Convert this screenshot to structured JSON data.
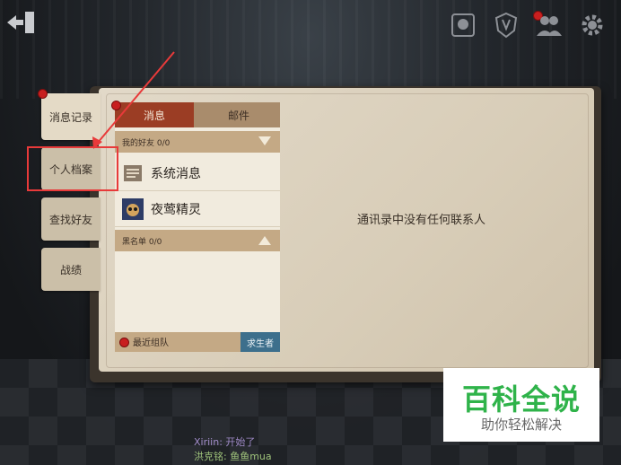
{
  "topbar": {
    "icons": [
      "exit-icon",
      "portrait-icon",
      "shield-icon",
      "friends-icon",
      "gear-icon"
    ]
  },
  "side_tabs": {
    "messages": "消息记录",
    "profile": "个人档案",
    "find_friends": "查找好友",
    "record": "战绩"
  },
  "panel": {
    "tab_messages": "消息",
    "tab_mail": "邮件",
    "friends_group": "我的好友  0/0",
    "rows": [
      "系统消息",
      "夜莺精灵"
    ],
    "blacklist_group": "黑名单  0/0",
    "recent_team": "最近组队",
    "survivor_button": "求生者"
  },
  "empty_text": "通讯录中没有任何联系人",
  "chat": {
    "line1": "Xiriin: 开始了",
    "line2": "洪克铭: 鱼鱼mua"
  },
  "watermark": {
    "title": "百科全说",
    "subtitle": "助你轻松解决"
  },
  "colors": {
    "active_tab": "#9b3d24",
    "annotation": "#e83a3a",
    "watermark_green": "#2fb34a",
    "survivor_button": "#3d6f8c"
  }
}
